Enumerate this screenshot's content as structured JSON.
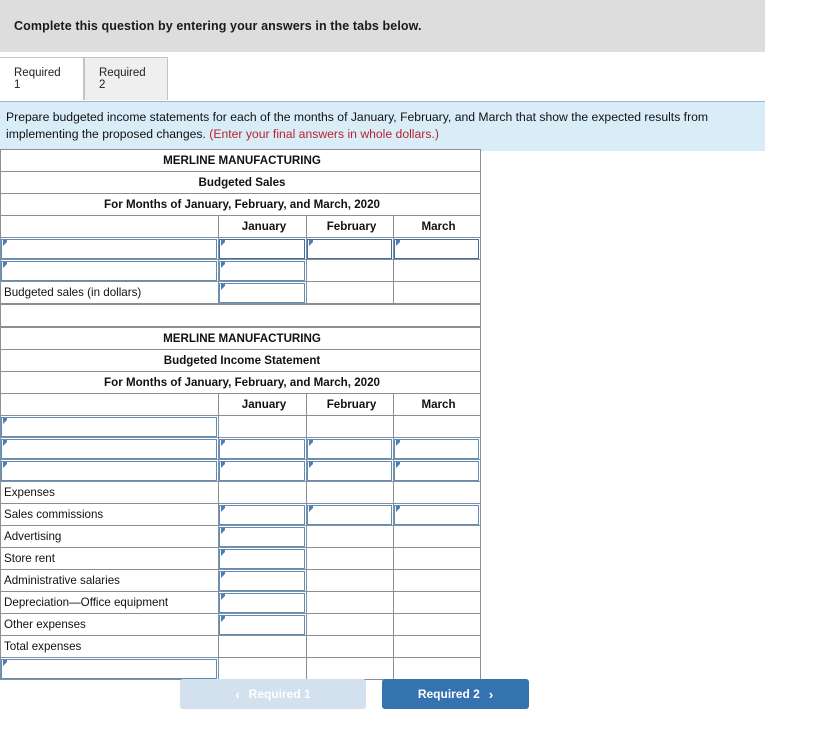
{
  "header": {
    "instruction": "Complete this question by entering your answers in the tabs below."
  },
  "tabs": [
    {
      "label": "Required 1",
      "active": true
    },
    {
      "label": "Required 2",
      "active": false
    }
  ],
  "banner": {
    "text": "Prepare budgeted income statements for each of the months of January, February, and March that show the expected results from implementing the proposed changes.",
    "note": "(Enter your final answers in whole dollars.)"
  },
  "tables": [
    {
      "id": "budgeted-sales",
      "title_lines": [
        "MERLINE MANUFACTURING",
        "Budgeted Sales",
        "For Months of January, February, and March, 2020"
      ],
      "columns": [
        "",
        "January",
        "February",
        "March"
      ],
      "rows": [
        {
          "label": "",
          "label_input": true,
          "inputs": [
            true,
            true,
            true
          ],
          "selected": true
        },
        {
          "label": "",
          "label_input": true,
          "inputs": [
            true,
            false,
            false
          ]
        },
        {
          "label": "Budgeted sales (in dollars)",
          "label_input": false,
          "inputs": [
            true,
            false,
            false
          ],
          "thick_bottom": true
        }
      ]
    },
    {
      "id": "budgeted-income-statement",
      "title_lines": [
        "MERLINE MANUFACTURING",
        "Budgeted Income Statement",
        "For Months of January, February, and March, 2020"
      ],
      "columns": [
        "",
        "January",
        "February",
        "March"
      ],
      "rows": [
        {
          "label": "",
          "label_input": true,
          "inputs": [
            false,
            false,
            false
          ]
        },
        {
          "label": "",
          "label_input": true,
          "inputs": [
            true,
            true,
            true
          ],
          "thick_bottom": true
        },
        {
          "label": "",
          "label_input": true,
          "inputs": [
            true,
            true,
            true
          ]
        },
        {
          "label": "Expenses",
          "label_input": false,
          "inputs": [
            false,
            false,
            false
          ]
        },
        {
          "label": "Sales commissions",
          "label_input": false,
          "indent": true,
          "inputs": [
            true,
            true,
            true
          ]
        },
        {
          "label": "Advertising",
          "label_input": false,
          "indent": true,
          "inputs": [
            true,
            false,
            false
          ]
        },
        {
          "label": "Store rent",
          "label_input": false,
          "indent": true,
          "inputs": [
            true,
            false,
            false
          ]
        },
        {
          "label": "Administrative salaries",
          "label_input": false,
          "indent": true,
          "inputs": [
            true,
            false,
            false
          ]
        },
        {
          "label": "Depreciation—Office equipment",
          "label_input": false,
          "indent": true,
          "inputs": [
            true,
            false,
            false
          ]
        },
        {
          "label": "Other expenses",
          "label_input": false,
          "indent": true,
          "inputs": [
            true,
            false,
            false
          ]
        },
        {
          "label": "Total expenses",
          "label_input": false,
          "inputs": [
            false,
            false,
            false
          ]
        },
        {
          "label": "",
          "label_input": true,
          "inputs": [
            false,
            false,
            false
          ],
          "thick_bottom": true
        }
      ]
    }
  ],
  "footer": {
    "prev_label": "Required 1",
    "next_label": "Required 2",
    "prev_icon": "chevron-left-icon",
    "next_icon": "chevron-right-icon",
    "prev_chevron": "‹",
    "next_chevron": "›"
  },
  "colors": {
    "table_header_blue": "#7eadde",
    "banner_blue": "#d9edf9",
    "topbar_grey": "#dddddd",
    "input_border": "#5c8ebd",
    "primary_button": "#3573b0",
    "disabled_button": "#d3e0ee",
    "note_red": "#b8242b"
  }
}
